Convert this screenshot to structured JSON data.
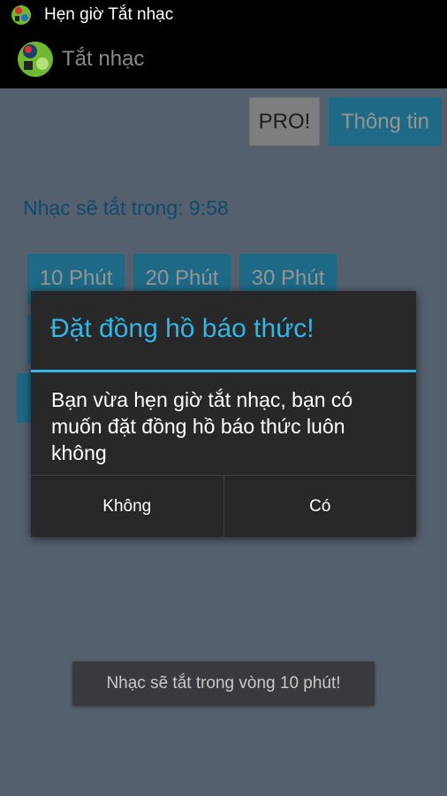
{
  "status_bar": {
    "app_icon": "music-timer-app-icon",
    "title": "Hẹn giờ Tắt nhạc"
  },
  "action_bar": {
    "logo_icon": "music-timer-app-icon",
    "title": "Tắt nhạc"
  },
  "toolbar": {
    "pro_label": "PRO!",
    "info_label": "Thông tin"
  },
  "countdown_text": "Nhạc sẽ tắt trong: 9:58",
  "minute_buttons": [
    {
      "label": "10 Phút"
    },
    {
      "label": "20 Phút"
    },
    {
      "label": "30 Phút"
    }
  ],
  "dialog": {
    "title": "Đặt đồng hồ báo thức!",
    "message": "Bạn vừa hẹn giờ tắt nhạc, bạn có muốn đặt đồng hồ báo thức luôn không",
    "negative_label": "Không",
    "positive_label": "Có"
  },
  "toast": {
    "text": "Nhạc sẽ tắt trong vòng 10 phút!"
  },
  "colors": {
    "accent": "#33b5e5",
    "countdown": "#1e7fb8",
    "dialog_bg": "#282828"
  }
}
